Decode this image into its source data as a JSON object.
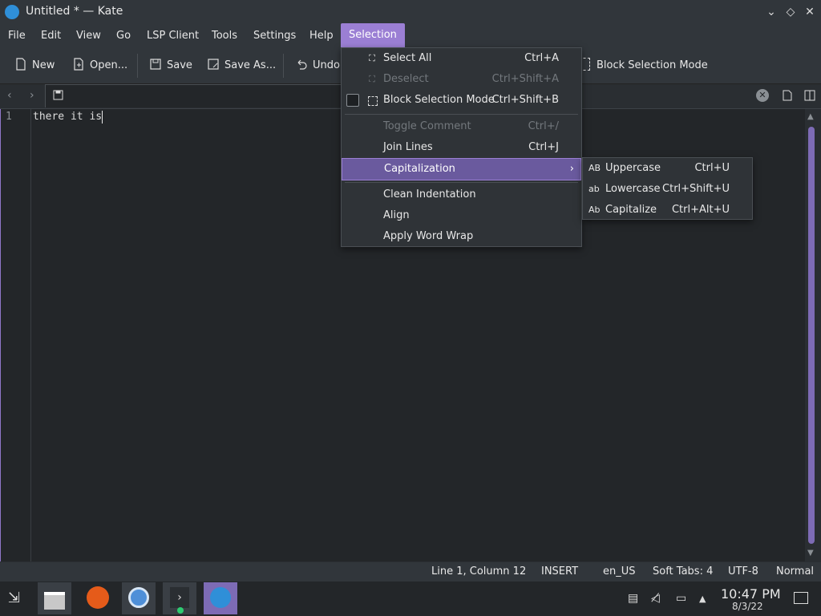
{
  "window": {
    "title": "Untitled * — Kate"
  },
  "menubar": [
    "File",
    "Edit",
    "View",
    "Go",
    "LSP Client",
    "Tools",
    "Settings",
    "Help",
    "Selection"
  ],
  "toolbar": {
    "new": "New",
    "open": "Open...",
    "save": "Save",
    "save_as": "Save As...",
    "undo": "Undo",
    "block_selection": "Block Selection Mode"
  },
  "editor": {
    "line_number": "1",
    "line_text": "there it is"
  },
  "status": {
    "position": "Line 1, Column 12",
    "mode": "INSERT",
    "dictionary": "en_US",
    "indent": "Soft Tabs: 4",
    "encoding": "UTF-8",
    "highlight": "Normal"
  },
  "taskbar": {
    "time": "10:47 PM",
    "date": "8/3/22"
  },
  "selection_menu": {
    "select_all": {
      "label": "Select All",
      "shortcut": "Ctrl+A"
    },
    "deselect": {
      "label": "Deselect",
      "shortcut": "Ctrl+Shift+A"
    },
    "block_selection": {
      "label": "Block Selection Mode",
      "shortcut": "Ctrl+Shift+B"
    },
    "toggle_comment": {
      "label": "Toggle Comment",
      "shortcut": "Ctrl+/"
    },
    "join_lines": {
      "label": "Join Lines",
      "shortcut": "Ctrl+J"
    },
    "capitalization": {
      "label": "Capitalization"
    },
    "clean_indentation": {
      "label": "Clean Indentation"
    },
    "align": {
      "label": "Align"
    },
    "apply_word_wrap": {
      "label": "Apply Word Wrap"
    }
  },
  "capitalization_menu": {
    "uppercase": {
      "label": "Uppercase",
      "shortcut": "Ctrl+U",
      "icon": "AB"
    },
    "lowercase": {
      "label": "Lowercase",
      "shortcut": "Ctrl+Shift+U",
      "icon": "ab"
    },
    "capitalize": {
      "label": "Capitalize",
      "shortcut": "Ctrl+Alt+U",
      "icon": "Ab"
    }
  }
}
